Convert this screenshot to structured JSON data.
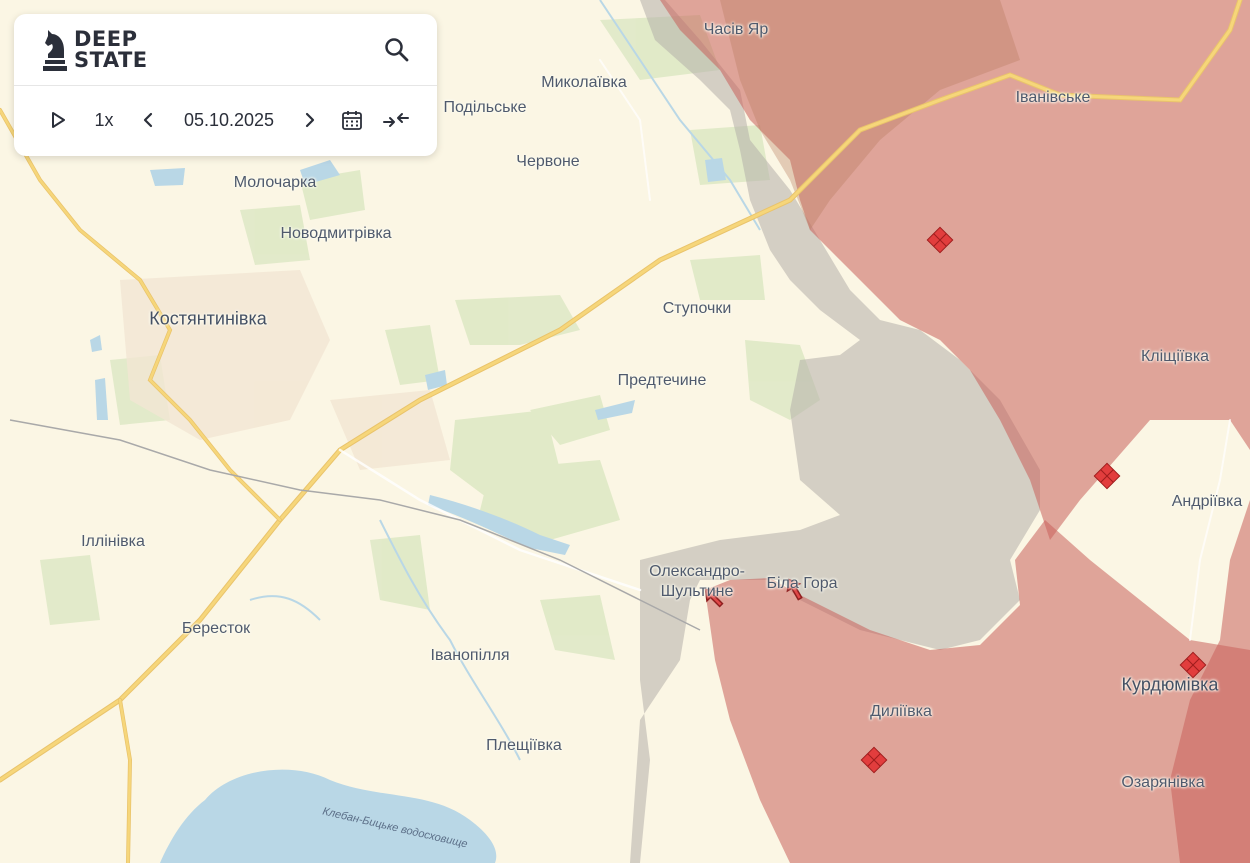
{
  "logo": {
    "line1": "DEEP",
    "line2": "STATE"
  },
  "icons": {
    "logo": "knight-chess-icon",
    "search": "search-icon",
    "play": "play-icon",
    "prev": "chevron-left-icon",
    "next": "chevron-right-icon",
    "calendar": "calendar-icon",
    "collapse": "collapse-arrows-icon"
  },
  "timeline": {
    "speed": "1x",
    "date": "05.10.2025"
  },
  "places": [
    "Часів Яр",
    "Миколаївка",
    "Подільське",
    "Іванівське",
    "Червоне",
    "Молочарка",
    "Новодмитрівка",
    "Ступочки",
    "Костянтинівка",
    "Кліщіївка",
    "Предтечине",
    "Андріївка",
    "Іллінівка",
    "Олександро-",
    "Шультине",
    "Біла Гора",
    "Бересток",
    "Іванопілля",
    "Курдюмівка",
    "Диліївка",
    "Плещіївка",
    "Озарянівка"
  ],
  "water_label": "Клебан-Бицьке водосховище",
  "colors": {
    "land": "#fbf6e4",
    "occupied": "#c8605b",
    "contested": "#b4aeaa",
    "forest": "#dfe9c6",
    "water": "#b9d7e6",
    "road": "#f0c84c",
    "marker": "#e23d3d"
  }
}
